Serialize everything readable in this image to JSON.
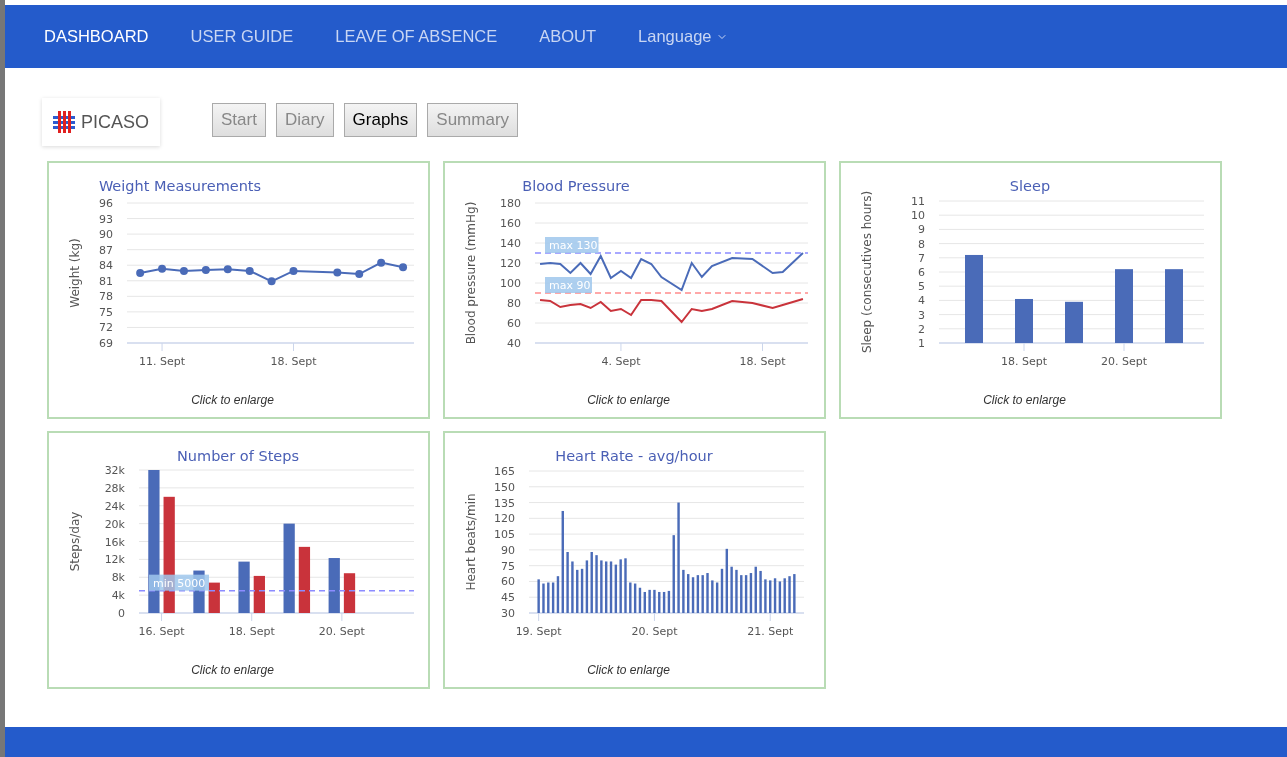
{
  "nav": {
    "items": [
      {
        "label": "DASHBOARD",
        "selected": true
      },
      {
        "label": "USER GUIDE",
        "selected": false
      },
      {
        "label": "LEAVE OF ABSENCE",
        "selected": false
      },
      {
        "label": "ABOUT",
        "selected": false
      }
    ],
    "language": {
      "label": "Language"
    }
  },
  "logo": {
    "text": "PICASO"
  },
  "tabs": [
    {
      "label": "Start",
      "selected": false
    },
    {
      "label": "Diary",
      "selected": false
    },
    {
      "label": "Graphs",
      "selected": true
    },
    {
      "label": "Summary",
      "selected": false
    }
  ],
  "charts": [
    {
      "hint": "Click to enlarge",
      "chart_data": {
        "type": "line",
        "title": "Weight Measurements",
        "ylabel": "Weight (kg)",
        "grid": true,
        "ylim": [
          69,
          96
        ],
        "yticks": [
          69,
          72,
          75,
          78,
          81,
          84,
          87,
          90,
          93,
          96
        ],
        "categories": [
          null,
          "11. Sept",
          null,
          null,
          null,
          null,
          null,
          "18. Sept",
          null,
          null,
          null,
          null,
          null
        ],
        "series": [
          {
            "color": "#4a6bb8",
            "marker": true,
            "values": [
              82.5,
              83.3,
              82.9,
              83.1,
              83.2,
              82.9,
              80.9,
              82.9,
              null,
              82.6,
              82.3,
              84.5,
              83.6
            ]
          }
        ]
      }
    },
    {
      "hint": "Click to enlarge",
      "chart_data": {
        "type": "line",
        "title": "Blood Pressure",
        "ylabel": "Blood pressure (mmHg)",
        "grid": true,
        "ylim": [
          40,
          180
        ],
        "yticks": [
          40,
          60,
          80,
          100,
          120,
          140,
          160,
          180
        ],
        "categories": [
          null,
          null,
          null,
          null,
          null,
          null,
          null,
          null,
          "4. Sept",
          null,
          null,
          null,
          null,
          null,
          null,
          null,
          null,
          null,
          null,
          null,
          null,
          null,
          "18. Sept",
          null,
          null,
          null,
          null
        ],
        "series": [
          {
            "color": "#4a6bb8",
            "values": [
              119,
              120,
              119,
              110,
              120,
              109,
              127,
              105,
              112,
              105,
              124,
              119,
              106,
              null,
              93,
              120,
              106,
              117,
              null,
              125,
              null,
              124,
              null,
              110,
              111,
              null,
              130
            ]
          },
          {
            "color": "#c9333b",
            "values": [
              83,
              82,
              76,
              78,
              79,
              75,
              81,
              72,
              74,
              68,
              83,
              83,
              82,
              null,
              61,
              74,
              72,
              74,
              null,
              82,
              null,
              80,
              null,
              75,
              78,
              null,
              84
            ]
          }
        ],
        "ref_lines": [
          {
            "axis": "y",
            "value": 130,
            "label": "max 130",
            "color": "#8c8cff"
          },
          {
            "axis": "y",
            "value": 90,
            "label": "max 90",
            "color": "#ff8c8c"
          }
        ]
      }
    },
    {
      "hint": "Click to enlarge",
      "chart_data": {
        "type": "bar",
        "title": "Sleep",
        "ylabel": "Sleep (consecutives hours)",
        "grid": true,
        "ylim": [
          1,
          11
        ],
        "yticks": [
          1,
          2,
          3,
          4,
          5,
          6,
          7,
          8,
          9,
          10,
          11
        ],
        "categories": [
          null,
          "18. Sept",
          null,
          "20. Sept",
          null
        ],
        "series": [
          {
            "color": "#4a6bb8",
            "values": [
              7.2,
              4.1,
              3.9,
              6.2,
              6.2
            ]
          }
        ]
      }
    },
    {
      "hint": "Click to enlarge",
      "chart_data": {
        "type": "bar",
        "title": "Number of Steps",
        "ylabel": "Steps/day",
        "grid": true,
        "ylim": [
          0,
          32000
        ],
        "yticks": [
          {
            "value": 0,
            "label": "0"
          },
          {
            "value": 4000,
            "label": "4k"
          },
          {
            "value": 8000,
            "label": "8k"
          },
          {
            "value": 12000,
            "label": "12k"
          },
          {
            "value": 16000,
            "label": "16k"
          },
          {
            "value": 20000,
            "label": "20k"
          },
          {
            "value": 24000,
            "label": "24k"
          },
          {
            "value": 28000,
            "label": "28k"
          },
          {
            "value": 32000,
            "label": "32k"
          }
        ],
        "categories": [
          "16. Sept",
          null,
          "18. Sept",
          null,
          "20. Sept"
        ],
        "series": [
          {
            "color": "#4a6bb8",
            "values": [
              32000,
              9500,
              11500,
              20000,
              12300
            ]
          },
          {
            "color": "#c9333b",
            "values": [
              26000,
              6800,
              8300,
              14800,
              8900
            ]
          }
        ],
        "ref_lines": [
          {
            "axis": "y",
            "value": 5000,
            "label": "min 5000",
            "color": "#8c8cff"
          }
        ]
      }
    },
    {
      "hint": "Click to enlarge",
      "chart_data": {
        "type": "bar",
        "title": "Heart Rate - avg/hour",
        "ylabel": "Heart beats/min",
        "grid": true,
        "ylim": [
          30,
          165
        ],
        "yticks": [
          30,
          45,
          60,
          75,
          90,
          105,
          120,
          135,
          150,
          165
        ],
        "categories": [
          "19. Sept",
          null,
          null,
          null,
          null,
          null,
          null,
          null,
          null,
          null,
          null,
          null,
          null,
          null,
          null,
          null,
          null,
          null,
          null,
          null,
          null,
          null,
          null,
          null,
          "20. Sept",
          null,
          null,
          null,
          null,
          null,
          null,
          null,
          null,
          null,
          null,
          null,
          null,
          null,
          null,
          null,
          null,
          null,
          null,
          null,
          null,
          null,
          null,
          null,
          "21. Sept",
          null,
          null,
          null,
          null,
          null
        ],
        "series": [
          {
            "color": "#4a6bb8",
            "values": [
              62,
              58,
              59,
              59,
              65,
              127,
              88,
              79,
              71,
              72,
              80,
              88,
              85,
              80,
              79,
              79,
              76,
              81,
              82,
              59,
              58,
              54,
              50,
              52,
              52,
              50,
              50,
              51,
              104,
              135,
              71,
              67,
              64,
              66,
              66,
              68,
              61,
              59,
              72,
              91,
              74,
              71,
              66,
              66,
              68,
              74,
              70,
              62,
              61,
              63,
              60,
              63,
              65,
              67
            ]
          }
        ]
      }
    }
  ]
}
